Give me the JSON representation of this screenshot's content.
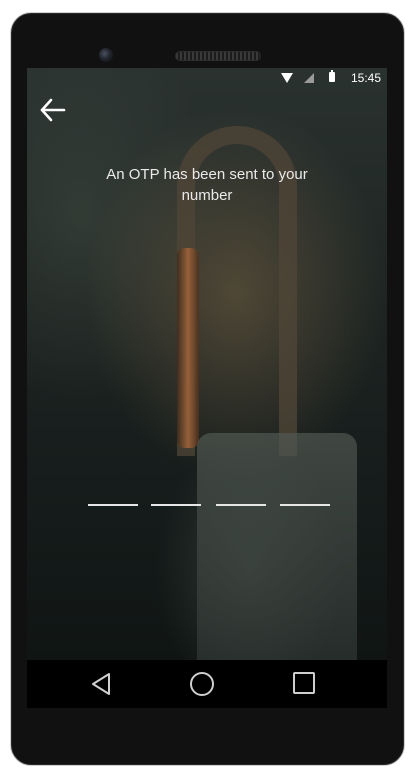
{
  "status_bar": {
    "time": "15:45",
    "icons": [
      "wifi-icon",
      "signal-icon",
      "battery-icon"
    ]
  },
  "header": {
    "back_icon": "arrow-left-icon"
  },
  "otp": {
    "message": "An OTP has been sent to your number",
    "fields": [
      "",
      "",
      "",
      ""
    ],
    "digit_count": 4
  },
  "nav_bar": {
    "icons": [
      "triangle-back-icon",
      "circle-home-icon",
      "square-recents-icon"
    ]
  },
  "colors": {
    "text": "#eaeaea",
    "underline": "#e6e6e6",
    "device": "#111111",
    "navbar": "#000000"
  }
}
